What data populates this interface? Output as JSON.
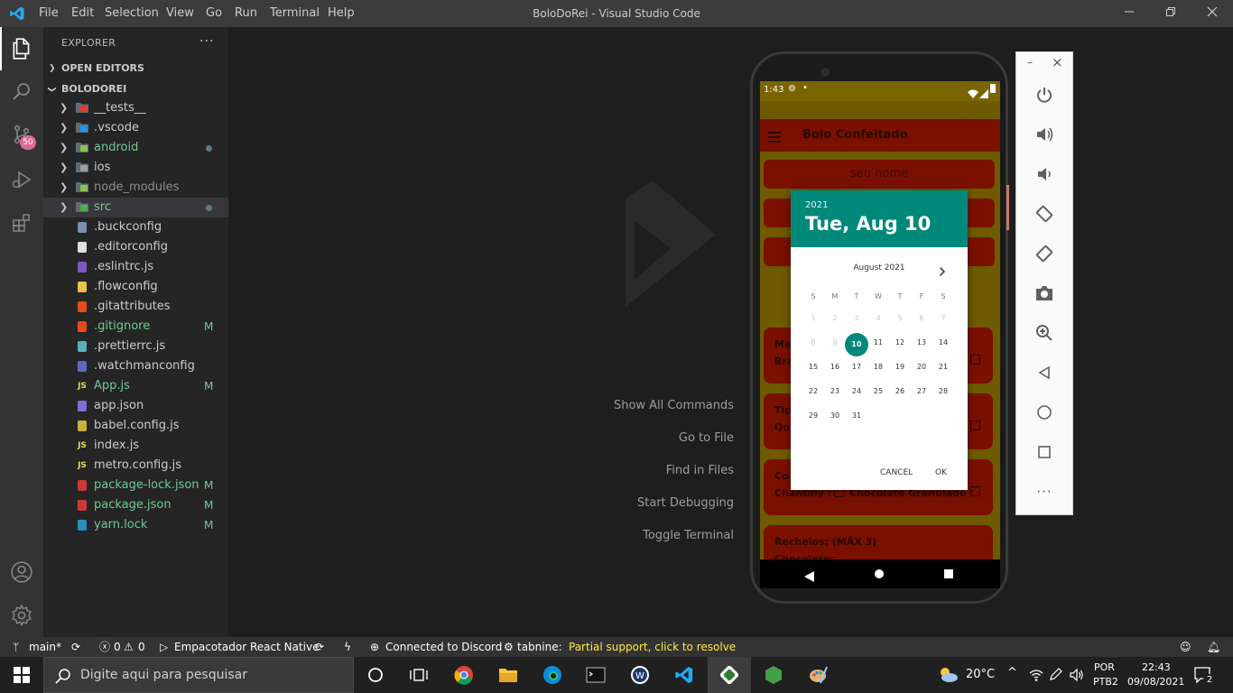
{
  "window": {
    "title": "BoloDoRei - Visual Studio Code",
    "menu": [
      "File",
      "Edit",
      "Selection",
      "View",
      "Go",
      "Run",
      "Terminal",
      "Help"
    ]
  },
  "activity_bar": {
    "source_control_badge": "50"
  },
  "sidebar": {
    "title": "EXPLORER",
    "more": "···",
    "open_editors": "OPEN EDITORS",
    "project": "BOLODOREI",
    "items": [
      {
        "name": "__tests__",
        "type": "folder",
        "color": "#cccccc",
        "icon_color": "#e53935",
        "mark": ""
      },
      {
        "name": ".vscode",
        "type": "folder",
        "color": "#cccccc",
        "icon_color": "#2196f3",
        "mark": ""
      },
      {
        "name": "android",
        "type": "folder",
        "color": "#73c991",
        "icon_color": "#8bc34a",
        "mark": "dot"
      },
      {
        "name": "ios",
        "type": "folder",
        "color": "#cccccc",
        "icon_color": "#9e9e9e",
        "mark": ""
      },
      {
        "name": "node_modules",
        "type": "folder",
        "color": "#8c8c8c",
        "icon_color": "#8bc34a",
        "mark": ""
      },
      {
        "name": "src",
        "type": "folder",
        "color": "#73c991",
        "icon_color": "#4caf50",
        "mark": "dot"
      },
      {
        "name": ".buckconfig",
        "type": "file",
        "color": "#cccccc",
        "icon_color": "#7a8fb0",
        "mark": ""
      },
      {
        "name": ".editorconfig",
        "type": "file",
        "color": "#cccccc",
        "icon_color": "#e0e0e0",
        "mark": ""
      },
      {
        "name": ".eslintrc.js",
        "type": "file",
        "color": "#cccccc",
        "icon_color": "#7e57c2",
        "mark": ""
      },
      {
        "name": ".flowconfig",
        "type": "file",
        "color": "#cccccc",
        "icon_color": "#e8c24a",
        "mark": ""
      },
      {
        "name": ".gitattributes",
        "type": "file",
        "color": "#cccccc",
        "icon_color": "#e64a19",
        "mark": ""
      },
      {
        "name": ".gitignore",
        "type": "file",
        "color": "#73c991",
        "icon_color": "#e64a19",
        "mark": "M"
      },
      {
        "name": ".prettierrc.js",
        "type": "file",
        "color": "#cccccc",
        "icon_color": "#56b3b4",
        "mark": ""
      },
      {
        "name": ".watchmanconfig",
        "type": "file",
        "color": "#cccccc",
        "icon_color": "#5c6bc0",
        "mark": ""
      },
      {
        "name": "App.js",
        "type": "file",
        "color": "#73c991",
        "icon_color": "#f0d84b",
        "icon_text": "JS",
        "mark": "M"
      },
      {
        "name": "app.json",
        "type": "file",
        "color": "#cccccc",
        "icon_color": "#7c6fd8",
        "mark": ""
      },
      {
        "name": "babel.config.js",
        "type": "file",
        "color": "#cccccc",
        "icon_color": "#c8b03a",
        "mark": ""
      },
      {
        "name": "index.js",
        "type": "file",
        "color": "#cccccc",
        "icon_color": "#f0d84b",
        "icon_text": "JS",
        "mark": ""
      },
      {
        "name": "metro.config.js",
        "type": "file",
        "color": "#cccccc",
        "icon_color": "#f0d84b",
        "icon_text": "JS",
        "mark": ""
      },
      {
        "name": "package-lock.json",
        "type": "file",
        "color": "#73c991",
        "icon_color": "#cb3837",
        "mark": "M"
      },
      {
        "name": "package.json",
        "type": "file",
        "color": "#73c991",
        "icon_color": "#cb3837",
        "mark": "M"
      },
      {
        "name": "yarn.lock",
        "type": "file",
        "color": "#73c991",
        "icon_color": "#2c8ebb",
        "mark": "M"
      }
    ]
  },
  "editor": {
    "commands": [
      "Show All Commands",
      "Go to File",
      "Find in Files",
      "Start Debugging",
      "Toggle Terminal"
    ]
  },
  "phone": {
    "status_time": "1:43",
    "app_title": "Bolo Confeitado",
    "name_field": "seu nome",
    "cards": [
      {
        "line1": "Ma",
        "line2": "Bra"
      },
      {
        "line1": "Tip",
        "line2": "Qu"
      },
      {
        "line1": "Co",
        "line2": "Chantilly :",
        "line2b": "Chocolate Granulado :"
      },
      {
        "line1": "Recheios: (MÁX 3)",
        "line2": "Chocolate:"
      }
    ],
    "dialog": {
      "year": "2021",
      "date": "Tue, Aug 10",
      "month": "August 2021",
      "weekdays": [
        "S",
        "M",
        "T",
        "W",
        "T",
        "F",
        "S"
      ],
      "rows": [
        [
          "1",
          "2",
          "3",
          "4",
          "5",
          "6",
          "7"
        ],
        [
          "8",
          "9",
          "10",
          "11",
          "12",
          "13",
          "14"
        ],
        [
          "15",
          "16",
          "17",
          "18",
          "19",
          "20",
          "21"
        ],
        [
          "22",
          "23",
          "24",
          "25",
          "26",
          "27",
          "28"
        ],
        [
          "29",
          "30",
          "31",
          "",
          "",
          "",
          ""
        ]
      ],
      "selected": "10",
      "cancel": "CANCEL",
      "ok": "OK",
      "accent": "#00897b"
    }
  },
  "emulator": {
    "close": "×",
    "minimize": "–",
    "more": "···"
  },
  "status_bar": {
    "branch": "main*",
    "errors": "0",
    "warnings": "0",
    "run_config": "Empacotador React Native",
    "discord": "Connected to Discord",
    "tabnine": "tabnine:",
    "tabnine_msg": "Partial support, click to resolve"
  },
  "taskbar": {
    "search_placeholder": "Digite aqui para pesquisar",
    "weather": "20°C",
    "lang1": "POR",
    "lang2": "PTB2",
    "time": "22:43",
    "date": "09/08/2021",
    "notif_count": "2"
  }
}
